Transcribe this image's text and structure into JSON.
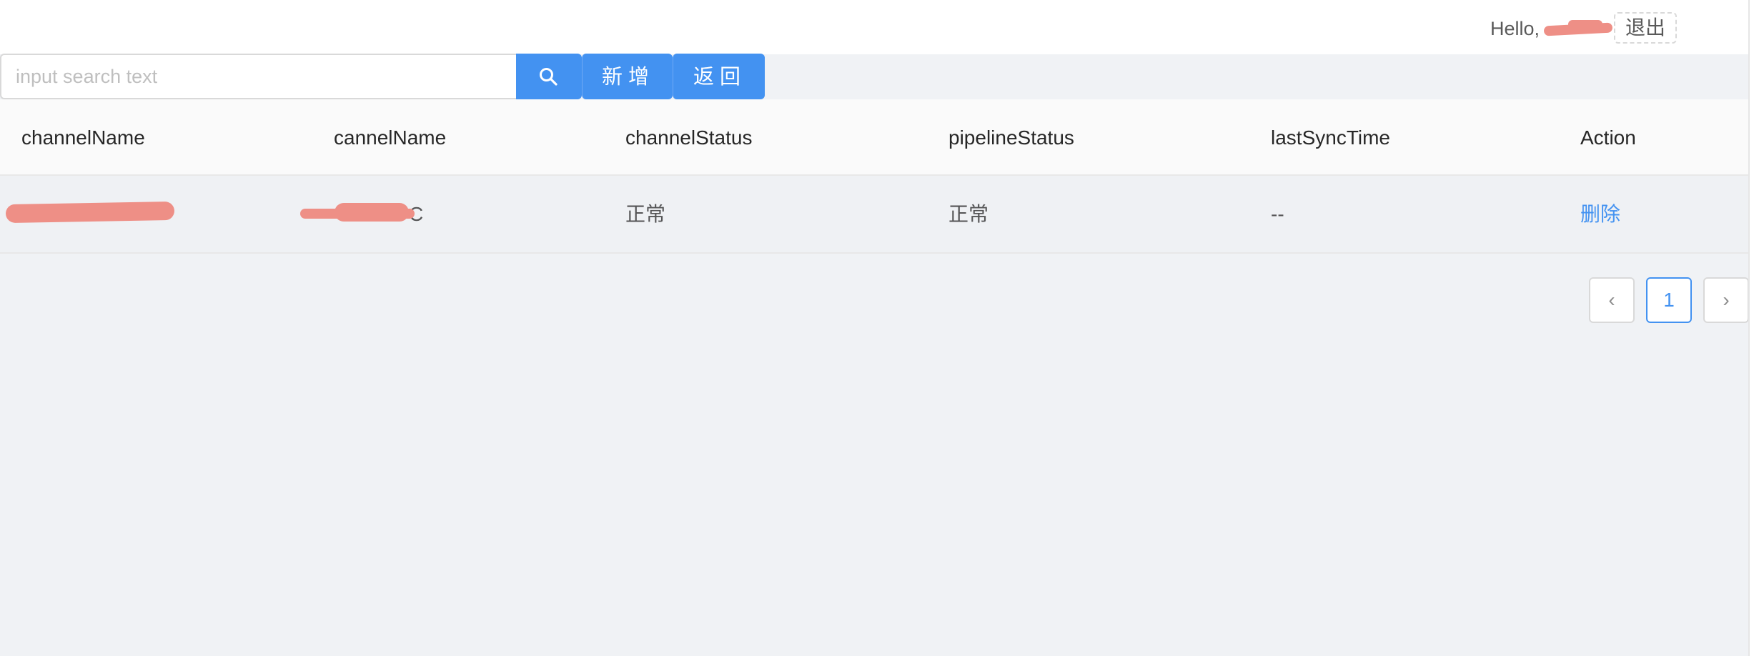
{
  "header": {
    "greeting_prefix": "Hello,",
    "greeting_suffix": "!",
    "logout_label": "退出"
  },
  "toolbar": {
    "search_placeholder": "input search text",
    "search_value": "",
    "search_icon": "search-icon",
    "add_label": "新增",
    "back_label": "返回"
  },
  "table": {
    "columns": [
      "channelName",
      "cannelName",
      "channelStatus",
      "pipelineStatus",
      "lastSyncTime",
      "Action"
    ],
    "rows": [
      {
        "channelName": "",
        "cannelName": "C",
        "channelStatus": "正常",
        "pipelineStatus": "正常",
        "lastSyncTime": "--",
        "action": "删除"
      }
    ]
  },
  "pagination": {
    "prev_symbol": "‹",
    "current_page": "1",
    "next_symbol": "›"
  },
  "colors": {
    "primary": "#4392f1",
    "background": "#f0f2f5",
    "redaction": "#ee8f86"
  }
}
